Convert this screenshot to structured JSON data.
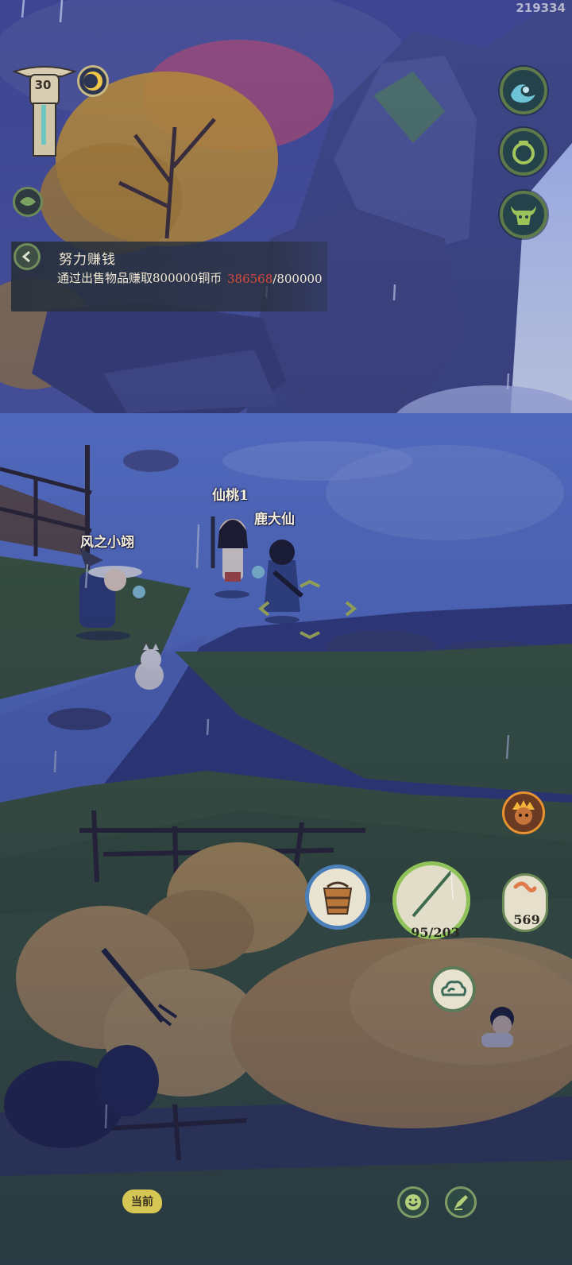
{
  "hud": {
    "player_id": "219334",
    "level": "30"
  },
  "quest": {
    "title": "努力赚钱",
    "description": "通过出售物品赚取800000铜币",
    "progress_current": "386568",
    "progress_total": "/800000"
  },
  "characters": [
    {
      "name": "仙桃1"
    },
    {
      "name": "鹿大仙"
    },
    {
      "name": "风之小翊"
    }
  ],
  "actions": {
    "rod_durability": "95/203",
    "bait_count": "569",
    "current_label": "当前"
  },
  "icons": {
    "coin": "gold-coin-icon",
    "leaf": "leaf-icon",
    "back": "back-arrow-icon",
    "wave": "wave-icon",
    "bag": "pouch-icon",
    "pet": "ox-head-icon",
    "monkey": "monkey-king-icon",
    "bucket": "bucket-icon",
    "rod": "fishing-rod-icon",
    "worm": "worm-bait-icon",
    "cloud": "cloud-icon",
    "emote": "smile-icon",
    "chat": "pen-icon"
  },
  "colors": {
    "sky": "#3b4690",
    "water": "#5e78d6",
    "grass": "#3f5a3e",
    "hay": "#c9a35a",
    "progress_highlight": "#d94a3a",
    "button_ring": "#5f7a4a"
  }
}
